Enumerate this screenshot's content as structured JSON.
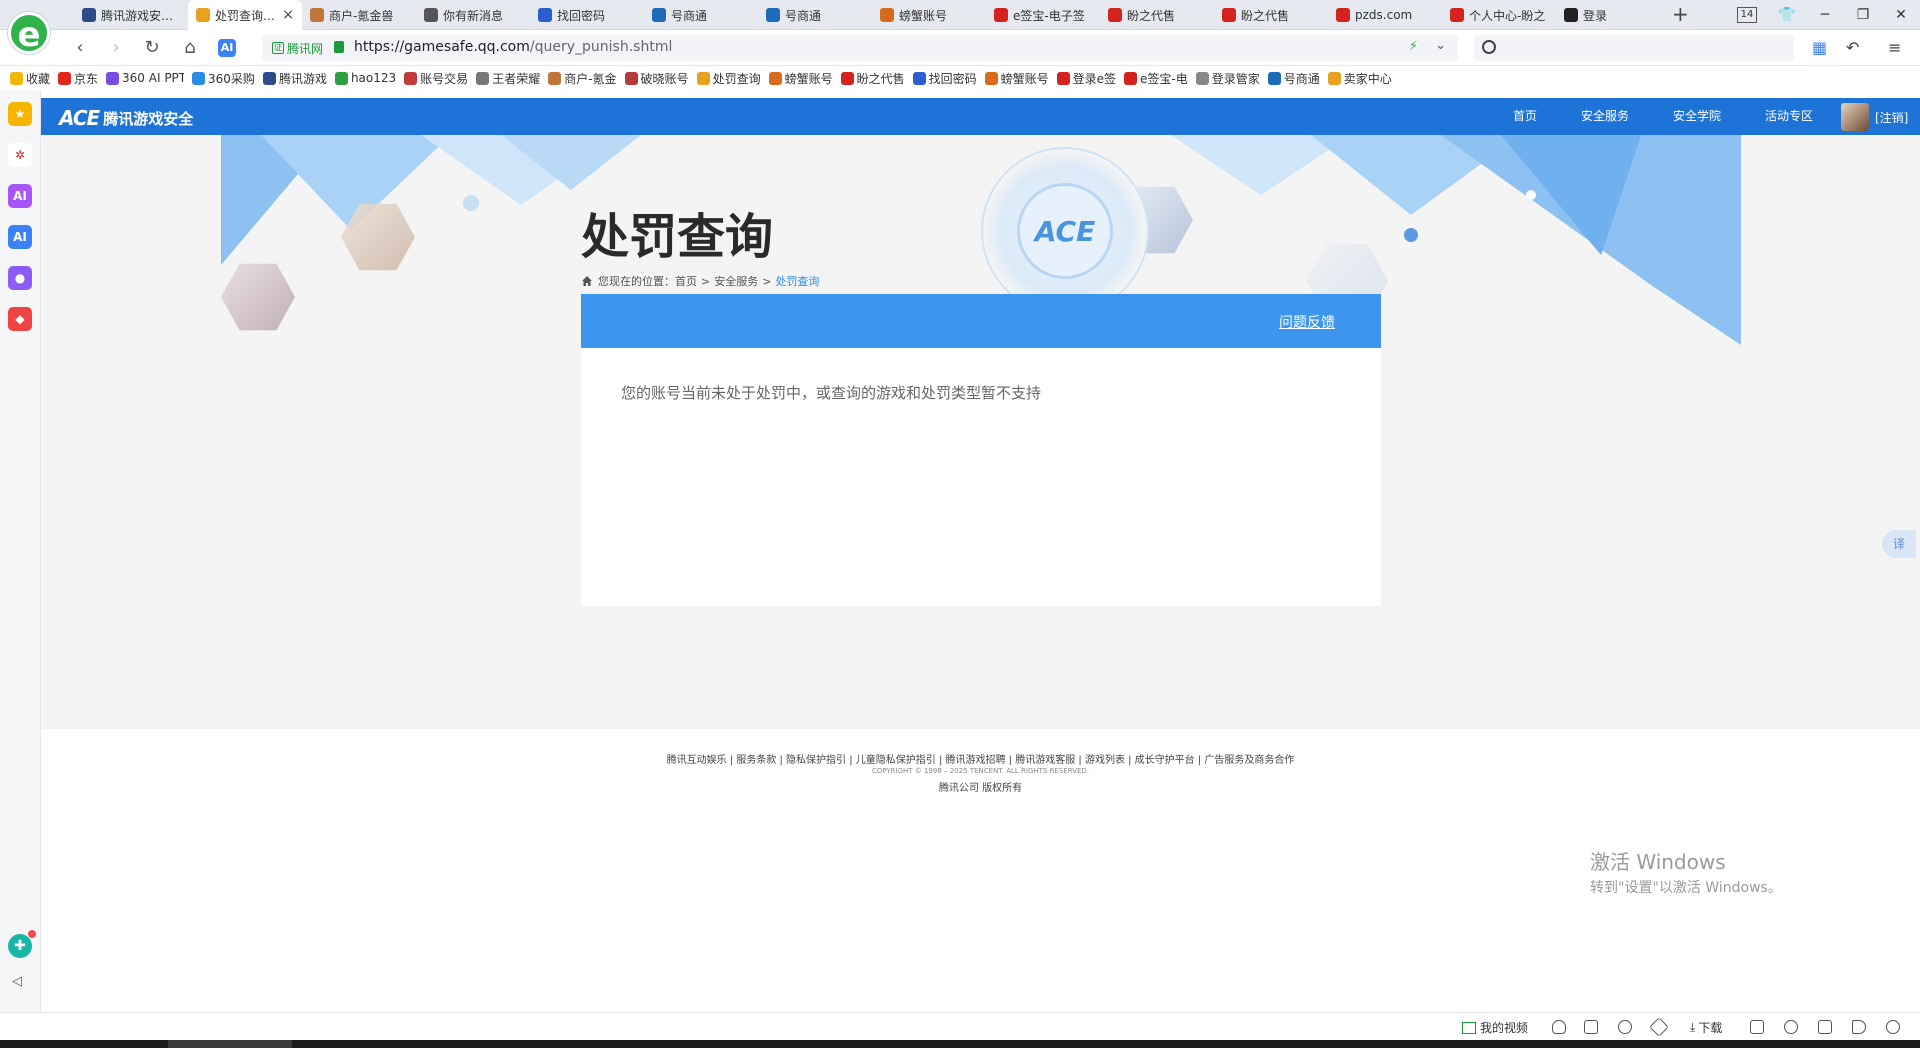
{
  "browser": {
    "tabs": [
      {
        "title": "腾讯游戏安全中心",
        "color": "#2d4c8a"
      },
      {
        "title": "处罚查询-腾讯游戏安全",
        "color": "#e8a21f",
        "active": true
      },
      {
        "title": "商户-氪金兽",
        "color": "#c0763a"
      },
      {
        "title": "你有新消息",
        "color": "#555555"
      },
      {
        "title": "找回密码",
        "color": "#2b5fcf"
      },
      {
        "title": "号商通",
        "color": "#1d6bb8"
      },
      {
        "title": "号商通",
        "color": "#1d6bb8"
      },
      {
        "title": "螃蟹账号",
        "color": "#d86a1e"
      },
      {
        "title": "e签宝-电子签",
        "color": "#d4231f"
      },
      {
        "title": "盼之代售",
        "color": "#d4231f"
      },
      {
        "title": "盼之代售",
        "color": "#d4231f"
      },
      {
        "title": "pzds.com",
        "color": "#d4231f"
      },
      {
        "title": "个人中心-盼之",
        "color": "#d4231f"
      },
      {
        "title": "登录",
        "color": "#222222"
      }
    ],
    "tab_count": "14",
    "address": {
      "secure_label": "腾讯网",
      "url_host": "https://gamesafe.qq.com",
      "url_path": "/query_punish.shtml"
    },
    "bookmarks": [
      {
        "label": "收藏",
        "color": "#f2b705"
      },
      {
        "label": "京东",
        "color": "#e1251b"
      },
      {
        "label": "360 AI PPT",
        "color": "#7a4ce0"
      },
      {
        "label": "360采购",
        "color": "#2b8ce6"
      },
      {
        "label": "腾讯游戏",
        "color": "#2d4c8a"
      },
      {
        "label": "hao123",
        "color": "#2ea043"
      },
      {
        "label": "账号交易",
        "color": "#c23b3b"
      },
      {
        "label": "王者荣耀",
        "color": "#777777"
      },
      {
        "label": "商户-氪金",
        "color": "#c0763a"
      },
      {
        "label": "破晓账号",
        "color": "#b53a3a"
      },
      {
        "label": "处罚查询",
        "color": "#e8a21f"
      },
      {
        "label": "螃蟹账号",
        "color": "#d86a1e"
      },
      {
        "label": "盼之代售",
        "color": "#d4231f"
      },
      {
        "label": "找回密码",
        "color": "#2b5fcf"
      },
      {
        "label": "螃蟹账号",
        "color": "#d86a1e"
      },
      {
        "label": "登录e签",
        "color": "#d4231f"
      },
      {
        "label": "e签宝-电",
        "color": "#d4231f"
      },
      {
        "label": "登录管家",
        "color": "#888888"
      },
      {
        "label": "号商通",
        "color": "#1d6bb8"
      },
      {
        "label": "卖家中心",
        "color": "#e8a21f"
      }
    ],
    "sidebar_icons": [
      {
        "name": "favorites-icon",
        "color": "#f6b500",
        "glyph": "★"
      },
      {
        "name": "network-icon",
        "color": "#ffffff",
        "glyph": "✲"
      },
      {
        "name": "ai-assistant-icon",
        "color": "#a855f7",
        "glyph": "AI"
      },
      {
        "name": "ai-icon",
        "color": "#3b82f6",
        "glyph": "AI"
      },
      {
        "name": "chat-icon",
        "color": "#8b5cf6",
        "glyph": "●"
      },
      {
        "name": "game-icon",
        "color": "#ef4444",
        "glyph": "◆"
      }
    ],
    "status": {
      "my_video": "我的视频",
      "download": "下载"
    },
    "watermark": {
      "line1": "激活 Windows",
      "line2": "转到\"设置\"以激活 Windows。"
    },
    "translate": "译"
  },
  "site": {
    "logo_mark": "ACE",
    "logo_name": "腾讯游戏安全",
    "nav": [
      "首页",
      "安全服务",
      "安全学院",
      "活动专区"
    ],
    "user_label": "[注销]",
    "emblem_text": "ACE",
    "page_title": "处罚查询",
    "breadcrumb": {
      "prefix": "您现在的位置：",
      "home": "首页",
      "sep": ">",
      "section": "安全服务",
      "current": "处罚查询"
    },
    "feedback": "问题反馈",
    "message": "您的账号当前未处于处罚中，或查询的游戏和处罚类型暂不支持",
    "footer": {
      "links": "腾讯互动娱乐 | 服务条款 | 隐私保护指引 | 儿童隐私保护指引 | 腾讯游戏招聘 | 腾讯游戏客服 | 游戏列表 | 成长守护平台 | 广告服务及商务合作",
      "copyright": "COPYRIGHT © 1998 – 2025 TENCENT. ALL RIGHTS RESERVED.",
      "company": "腾讯公司 版权所有"
    },
    "colors": {
      "header": "#1e73d9",
      "panel_head": "#3c95ee",
      "breadcrumb_current": "#2b8ce6"
    }
  }
}
